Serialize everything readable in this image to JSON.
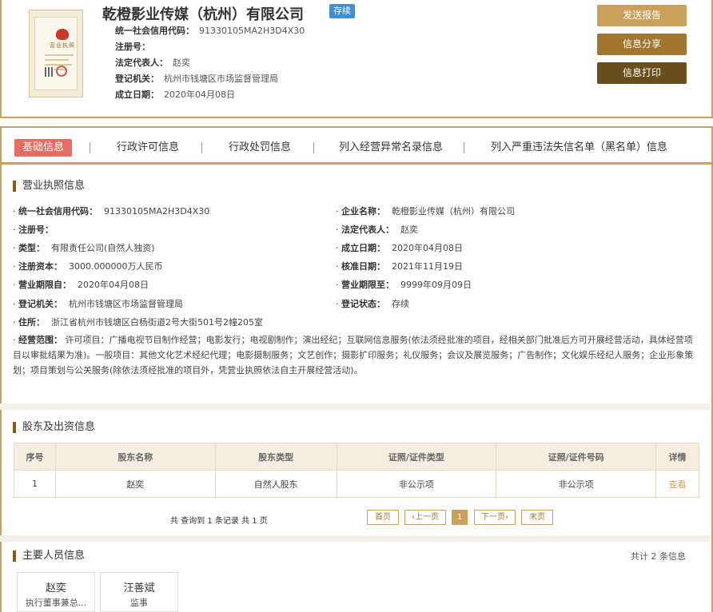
{
  "header": {
    "company_name": "乾橙影业传媒（杭州）有限公司",
    "status": "存续",
    "fields": [
      {
        "label": "统一社会信用代码：",
        "value": "91330105MA2H3D4X30"
      },
      {
        "label": "注册号：",
        "value": ""
      },
      {
        "label": "法定代表人：",
        "value": "赵奕"
      },
      {
        "label": "登记机关：",
        "value": "杭州市钱塘区市场监督管理局"
      },
      {
        "label": "成立日期：",
        "value": "2020年04月08日"
      }
    ],
    "license_title": "营业执照",
    "buttons": {
      "report": "发送报告",
      "share": "信息分享",
      "print": "信息打印"
    }
  },
  "tabs": [
    "基础信息",
    "行政许可信息",
    "行政处罚信息",
    "列入经营异常名录信息",
    "列入严重违法失信名单（黑名单）信息"
  ],
  "license_section": {
    "title": "营业执照信息",
    "left": [
      {
        "label": "统一社会信用代码：",
        "value": "91330105MA2H3D4X30"
      },
      {
        "label": "注册号：",
        "value": ""
      },
      {
        "label": "类型：",
        "value": "有限责任公司(自然人独资)"
      },
      {
        "label": "注册资本：",
        "value": "3000.000000万人民币"
      },
      {
        "label": "营业期限自：",
        "value": "2020年04月08日"
      },
      {
        "label": "登记机关：",
        "value": "杭州市钱塘区市场监督管理局"
      }
    ],
    "right": [
      {
        "label": "企业名称：",
        "value": "乾橙影业传媒（杭州）有限公司"
      },
      {
        "label": "法定代表人：",
        "value": "赵奕"
      },
      {
        "label": "成立日期：",
        "value": "2020年04月08日"
      },
      {
        "label": "核准日期：",
        "value": "2021年11月19日"
      },
      {
        "label": "营业期限至：",
        "value": "9999年09月09日"
      },
      {
        "label": "登记状态：",
        "value": "存续"
      }
    ],
    "address": {
      "label": "住所：",
      "value": "浙江省杭州市钱塘区白杨街道2号大街501号2幢205室"
    },
    "scope": {
      "label": "经营范围：",
      "value": "许可项目：广播电视节目制作经营；电影发行；电视剧制作；演出经纪；互联网信息服务(依法须经批准的项目，经相关部门批准后方可开展经营活动，具体经营项目以审批结果为准)。一般项目：其他文化艺术经纪代理；电影摄制服务；文艺创作；摄影扩印服务；礼仪服务；会议及展览服务；广告制作；文化娱乐经纪人服务；企业形象策划；项目策划与公关服务(除依法须经批准的项目外，凭营业执照依法自主开展经营活动)。"
    }
  },
  "shareholders": {
    "title": "股东及出资信息",
    "columns": [
      "序号",
      "股东名称",
      "股东类型",
      "证照/证件类型",
      "证照/证件号码",
      "详情"
    ],
    "rows": [
      [
        "1",
        "赵奕",
        "自然人股东",
        "非公示项",
        "非公示项",
        "查看"
      ]
    ],
    "pager_info": "共 查询到 1 条记录 共 1 页",
    "pager": {
      "first": "首页",
      "prev": "上一页",
      "current": "1",
      "next": "下一页",
      "last": "末页"
    }
  },
  "people": {
    "title": "主要人员信息",
    "count": "共计 2 条信息",
    "items": [
      {
        "name": "赵奕",
        "role": "执行董事兼总..."
      },
      {
        "name": "汪善斌",
        "role": "监事"
      }
    ]
  },
  "colors": {
    "gold": "#c9a15a",
    "tab_active": "#e46c63",
    "status": "#3f8fd2"
  }
}
